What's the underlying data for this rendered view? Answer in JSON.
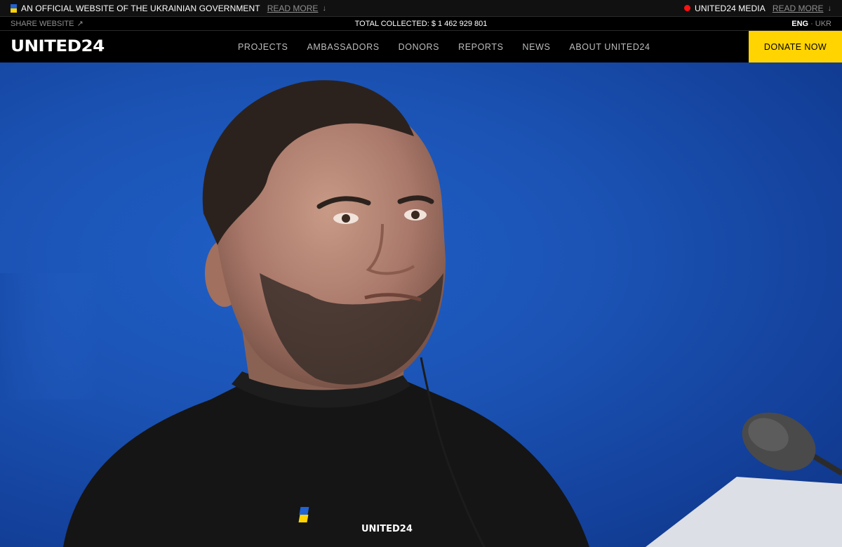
{
  "topbar": {
    "official_text": "AN OFFICIAL WEBSITE OF THE UKRAINIAN GOVERNMENT",
    "read_more_left": "READ MORE",
    "media_text": "UNITED24 MEDIA",
    "read_more_right": "READ MORE",
    "flag_colors": [
      "#1f63d6",
      "#ffd400"
    ],
    "live_dot_color": "#ff1111"
  },
  "subbar": {
    "share_label": "SHARE WEBSITE",
    "total_collected": "TOTAL COLLECTED: $ 1 462 929 801",
    "lang_active": "ENG",
    "lang_sep": "·",
    "lang_inactive": "UKR"
  },
  "nav": {
    "logo": "UNITED24",
    "items": [
      "PROJECTS",
      "AMBASSADORS",
      "DONORS",
      "REPORTS",
      "NEWS",
      "ABOUT UNITED24"
    ],
    "donate_label": "DONATE NOW",
    "donate_color": "#ffd400"
  },
  "hero": {
    "sweater_logo": "UNITED24",
    "background_color": "#1b53b4"
  }
}
